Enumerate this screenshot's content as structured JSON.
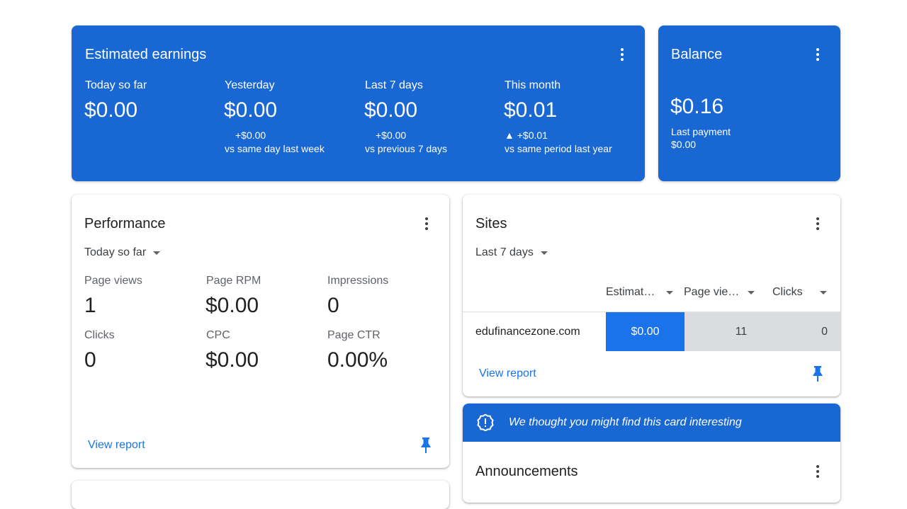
{
  "estimated_earnings": {
    "title": "Estimated earnings",
    "columns": [
      {
        "label": "Today so far",
        "value": "$0.00",
        "delta": "",
        "compare": ""
      },
      {
        "label": "Yesterday",
        "value": "$0.00",
        "delta": "+$0.00",
        "compare": "vs same day last week"
      },
      {
        "label": "Last 7 days",
        "value": "$0.00",
        "delta": "+$0.00",
        "compare": "vs previous 7 days"
      },
      {
        "label": "This month",
        "value": "$0.01",
        "delta": "▲ +$0.01",
        "compare": "vs same period last year"
      }
    ]
  },
  "balance": {
    "title": "Balance",
    "value": "$0.16",
    "last_payment_label": "Last payment",
    "last_payment_value": "$0.00"
  },
  "performance": {
    "title": "Performance",
    "range": "Today so far",
    "metrics": [
      {
        "label": "Page views",
        "value": "1"
      },
      {
        "label": "Page RPM",
        "value": "$0.00"
      },
      {
        "label": "Impressions",
        "value": "0"
      },
      {
        "label": "Clicks",
        "value": "0"
      },
      {
        "label": "CPC",
        "value": "$0.00"
      },
      {
        "label": "Page CTR",
        "value": "0.00%"
      }
    ],
    "view_report": "View report"
  },
  "sites": {
    "title": "Sites",
    "range": "Last 7 days",
    "columns": [
      "Estimat…",
      "Page vie…",
      "Clicks"
    ],
    "rows": [
      {
        "site": "edufinancezone.com",
        "earnings": "$0.00",
        "page_views": "11",
        "clicks": "0"
      }
    ],
    "view_report": "View report"
  },
  "tip": {
    "text": "We thought you might find this card interesting"
  },
  "announcements": {
    "title": "Announcements"
  },
  "colors": {
    "brand_blue": "#1967d2",
    "highlight_blue": "#1a73e8",
    "link_blue": "#1a73e8",
    "row_gray": "#dadce0"
  }
}
